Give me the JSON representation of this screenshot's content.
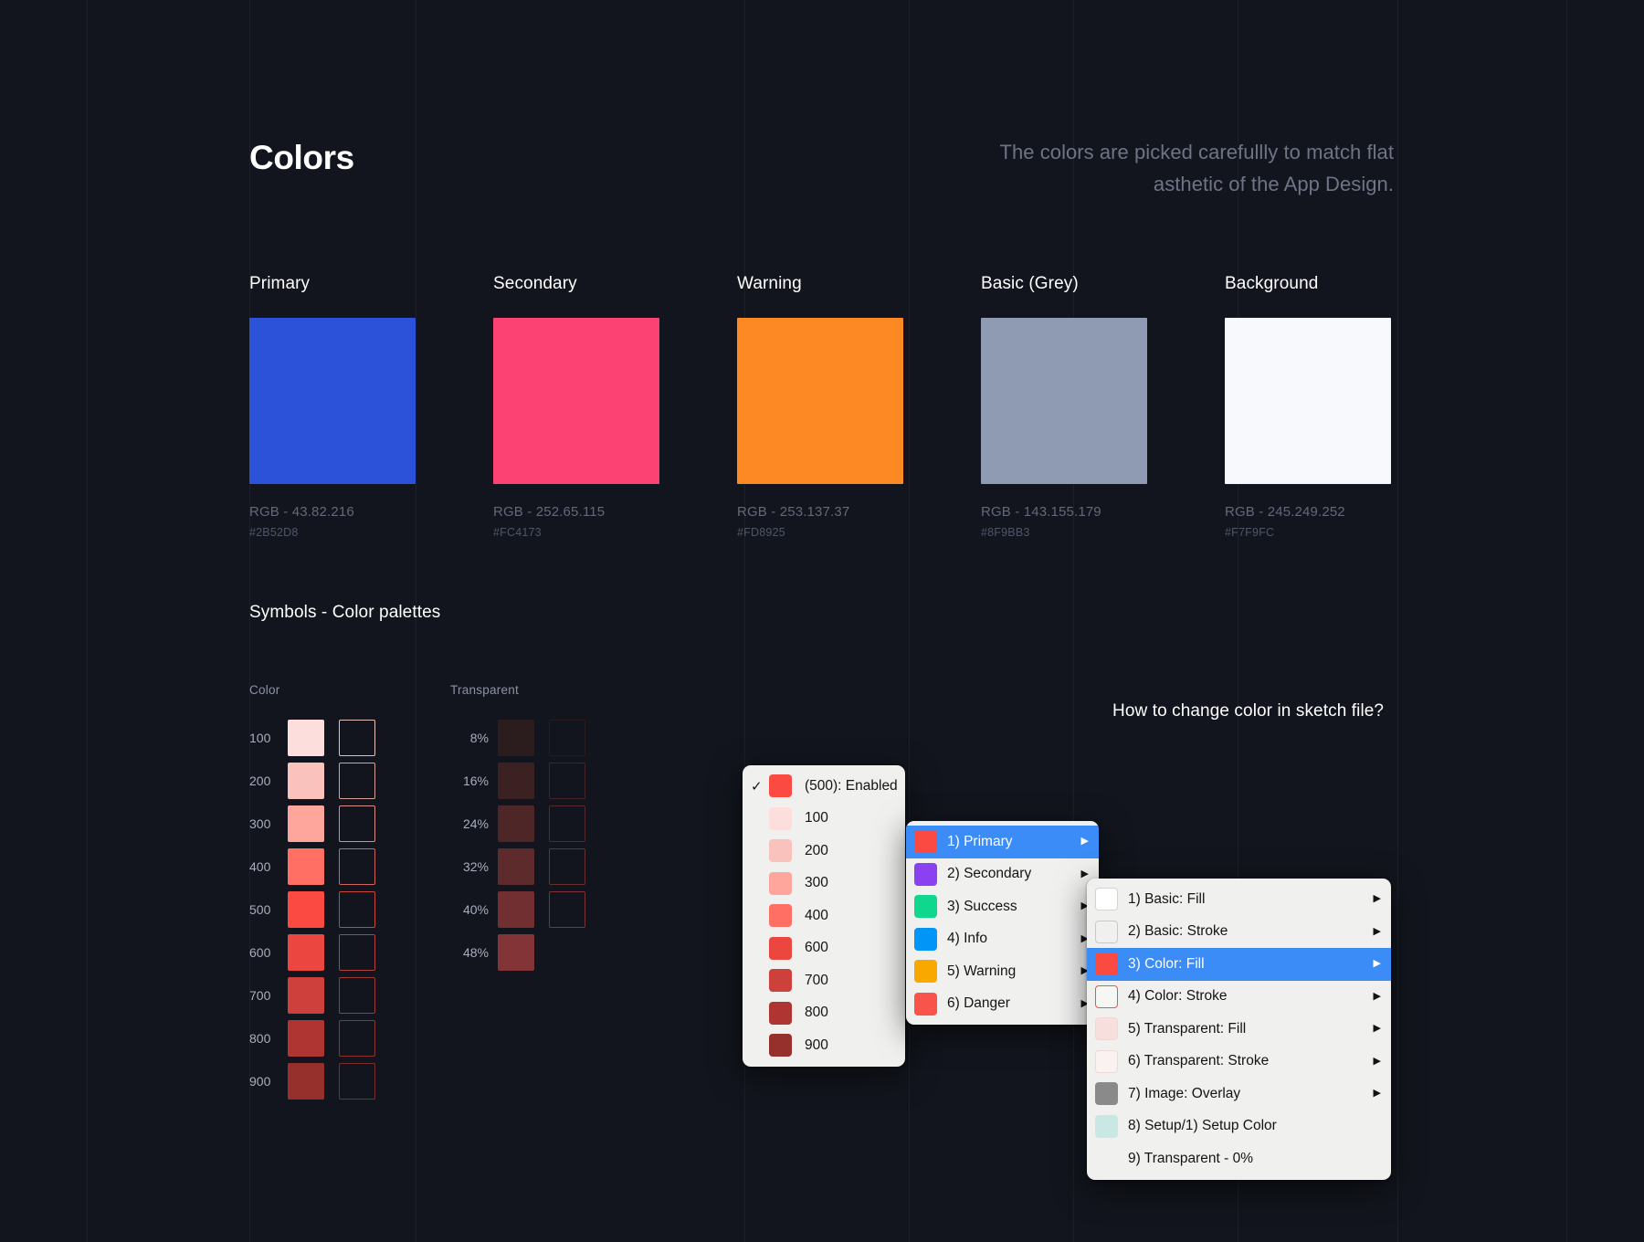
{
  "header": {
    "title": "Colors",
    "subtitle": "The colors are picked carefullly to match flat asthetic of the App Design."
  },
  "palette_swatches": [
    {
      "name": "Primary",
      "rgb": "RGB - 43.82.216",
      "hex": "#2B52D8",
      "color": "#2B52D8"
    },
    {
      "name": "Secondary",
      "rgb": "RGB - 252.65.115",
      "hex": "#FC4173",
      "color": "#FC4173"
    },
    {
      "name": "Warning",
      "rgb": "RGB - 253.137.37",
      "hex": "#FD8925",
      "color": "#FD8925"
    },
    {
      "name": "Basic (Grey)",
      "rgb": "RGB - 143.155.179",
      "hex": "#8F9BB3",
      "color": "#8F9BB3"
    },
    {
      "name": "Background",
      "rgb": "RGB - 245.249.252",
      "hex": "#F7F9FC",
      "color": "#F7F9FC"
    }
  ],
  "symbols": {
    "section_title": "Symbols - Color palettes",
    "color_group": {
      "heading": "Color",
      "rows": [
        {
          "label": "100",
          "fill": "#FCDFDD",
          "stroke": "#E8BFBB"
        },
        {
          "label": "200",
          "fill": "#FAC2BD",
          "stroke": "#D8A09B"
        },
        {
          "label": "300",
          "fill": "#FFA69C",
          "stroke": "#D98E84"
        },
        {
          "label": "400",
          "fill": "#FF6F64",
          "stroke": "#D0655C"
        },
        {
          "label": "500",
          "fill": "#FA4A42",
          "stroke": "#C9443D"
        },
        {
          "label": "600",
          "fill": "#EB4740",
          "stroke": "#B4413A"
        },
        {
          "label": "700",
          "fill": "#CE403C",
          "stroke": "#9E3A36"
        },
        {
          "label": "800",
          "fill": "#AE3532",
          "stroke": "#8A3330"
        },
        {
          "label": "900",
          "fill": "#96302D",
          "stroke": "#7A2E2B"
        }
      ]
    },
    "transparent_group": {
      "heading": "Transparent",
      "rows": [
        {
          "label": "8%",
          "fill": "#2B1C1E",
          "stroke": "#2A1C1E"
        },
        {
          "label": "16%",
          "fill": "#3C2123",
          "stroke": "#452325"
        },
        {
          "label": "24%",
          "fill": "#4E2628",
          "stroke": "#57292B"
        },
        {
          "label": "32%",
          "fill": "#5E2B2D",
          "stroke": "#6B2F30"
        },
        {
          "label": "40%",
          "fill": "#712F31",
          "stroke": "#7E3436"
        },
        {
          "label": "48%",
          "fill": "#823436",
          "stroke": ""
        }
      ]
    }
  },
  "question": "How to change color in sketch file?",
  "menus": {
    "shades": {
      "items": [
        {
          "label": "(500): Enabled",
          "swatch": "#FA4A42",
          "checked": true
        },
        {
          "label": "100",
          "swatch": "#FCDFDD",
          "checked": false
        },
        {
          "label": "200",
          "swatch": "#FAC2BD",
          "checked": false
        },
        {
          "label": "300",
          "swatch": "#FFA69C",
          "checked": false
        },
        {
          "label": "400",
          "swatch": "#FF6F64",
          "checked": false
        },
        {
          "label": "600",
          "swatch": "#EB4740",
          "checked": false
        },
        {
          "label": "700",
          "swatch": "#CE403C",
          "checked": false
        },
        {
          "label": "800",
          "swatch": "#AE3532",
          "checked": false
        },
        {
          "label": "900",
          "swatch": "#96302D",
          "checked": false
        }
      ]
    },
    "categories": {
      "items": [
        {
          "label": "1) Primary",
          "swatch": "#FA4A42",
          "arrow": true,
          "selected": true
        },
        {
          "label": "2) Secondary",
          "swatch": "#8B41F0",
          "arrow": true,
          "selected": false
        },
        {
          "label": "3) Success",
          "swatch": "#0FD78E",
          "arrow": true,
          "selected": false
        },
        {
          "label": "4) Info",
          "swatch": "#0095F6",
          "arrow": true,
          "selected": false
        },
        {
          "label": "5) Warning",
          "swatch": "#F9A800",
          "arrow": true,
          "selected": false
        },
        {
          "label": "6) Danger",
          "swatch": "#F9544B",
          "arrow": true,
          "selected": false
        }
      ]
    },
    "layers": {
      "items": [
        {
          "label": "1) Basic: Fill",
          "swatch": "#FFFFFF",
          "border": "#D3D3D1",
          "arrow": true,
          "selected": false
        },
        {
          "label": "2) Basic: Stroke",
          "swatch": "#F0F0EF",
          "border": "#C9C9C7",
          "arrow": true,
          "selected": false
        },
        {
          "label": "3) Color: Fill",
          "swatch": "#FA4A42",
          "border": "#FA4A42",
          "arrow": true,
          "selected": true
        },
        {
          "label": "4) Color: Stroke",
          "swatch": "#F6F6F5",
          "border": "#F0524A",
          "arrow": true,
          "selected": false
        },
        {
          "label": "5) Transparent: Fill",
          "swatch": "#F7DFDE",
          "border": "#F1D6D5",
          "arrow": true,
          "selected": false
        },
        {
          "label": "6) Transparent: Stroke",
          "swatch": "#FAF2F1",
          "border": "#EFD9D7",
          "arrow": true,
          "selected": false
        },
        {
          "label": "7) Image: Overlay",
          "swatch": "#8A8A8A",
          "border": "#8A8A8A",
          "arrow": true,
          "selected": false
        },
        {
          "label": "8) Setup/1) Setup Color",
          "swatch": "#C9E8E3",
          "border": "#C9E8E3",
          "arrow": false,
          "selected": false
        },
        {
          "label": "9) Transparent - 0%",
          "swatch": "",
          "border": "",
          "arrow": false,
          "selected": false
        }
      ]
    }
  },
  "icons": {
    "check": "✓",
    "submenu_arrow": "▶"
  },
  "guide_positions": [
    95,
    273,
    455,
    815,
    995,
    1175,
    1355,
    1530,
    1715
  ],
  "theme": {
    "background": "#12151d",
    "guide_line": "rgba(255,255,255,0.045)",
    "title_color": "#ffffff",
    "subtitle_color": "#6d7486",
    "menu_background": "#f0f0ef",
    "menu_highlight": "#3b8cf6"
  }
}
